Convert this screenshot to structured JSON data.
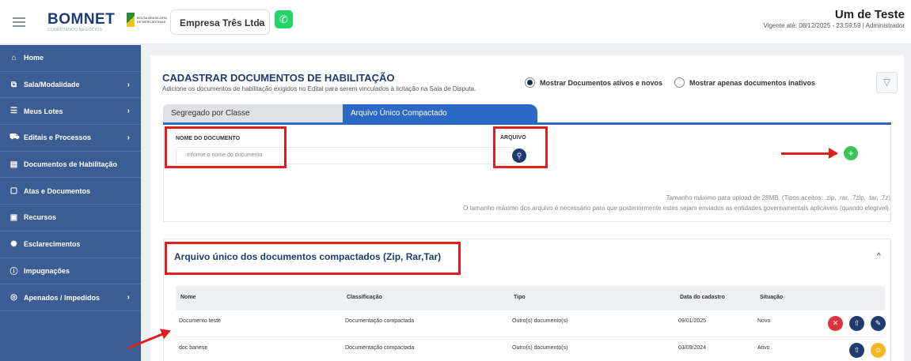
{
  "header": {
    "logo": "BOMNET",
    "logo_sub": "CONECTANDO NEGÓCIOS",
    "bolsa_text": "BOLSA BRASILEIRA DE MERCADORIAS",
    "company": "Empresa Três Ltda",
    "user_name": "Um de Teste",
    "vigente": "Vigente até: 08/12/2025 - 23:59:59 | Administrador"
  },
  "sidebar": {
    "items": [
      {
        "label": "Home",
        "icon": "home-icon",
        "glyph": "⌂",
        "arrow": ""
      },
      {
        "label": "Sala/Modalidade",
        "icon": "rooms-icon",
        "glyph": "⧉",
        "arrow": "›"
      },
      {
        "label": "Meus Lotes",
        "icon": "lots-icon",
        "glyph": "☰",
        "arrow": "›"
      },
      {
        "label": "Editais e Processos",
        "icon": "cart-icon",
        "glyph": "⛟",
        "arrow": "›"
      },
      {
        "label": "Documentos de Habilitação",
        "icon": "document-icon",
        "glyph": "▤",
        "arrow": ""
      },
      {
        "label": "Atas e Documentos",
        "icon": "file-icon",
        "glyph": "▢",
        "arrow": ""
      },
      {
        "label": "Recursos",
        "icon": "resources-icon",
        "glyph": "▣",
        "arrow": ""
      },
      {
        "label": "Esclarecimentos",
        "icon": "sun-icon",
        "glyph": "✺",
        "arrow": ""
      },
      {
        "label": "Impugnações",
        "icon": "info-icon",
        "glyph": "ⓘ",
        "arrow": ""
      },
      {
        "label": "Apenados / Impedidos",
        "icon": "blocked-icon",
        "glyph": "◎",
        "arrow": "›"
      }
    ]
  },
  "page": {
    "title": "CADASTRAR DOCUMENTOS DE HABILITAÇÃO",
    "subtitle": "Adicione os documentos de habilitação exigidos no Edital para serem vinculados à licitação na Sala de Disputa.",
    "radio_active": "Mostrar Documentos ativos e novos",
    "radio_inactive": "Mostrar apenas documentos inativos",
    "tab1": "Segregado por Classe",
    "tab2": "Arquivo Único Compactado"
  },
  "form": {
    "nome_label": "NOME DO DOCUMENTO",
    "nome_placeholder": "Informe o nome do documento",
    "arquivo_label": "ARQUIVO",
    "hint1": "Tamanho máximo para upload de 28MB. (Tipos aceitos: .zip, .rar, .7zip, .tar, .7z)",
    "hint2": "O tamanho máximo dos arquivo é necessário para que posteriormente estes sejam enviados as entidades governamentais aplicáveis (quando elegível)."
  },
  "section": {
    "title": "Arquivo único dos documentos compactados (Zip, Rar,Tar)",
    "columns": [
      "Nome",
      "Classificação",
      "Tipo",
      "Data do cadastro",
      "Situação"
    ],
    "rows": [
      {
        "nome": "Documento teste",
        "classificacao": "Documentação compactada",
        "tipo": "Outro(s) documento(s)",
        "data": "09/01/2025",
        "situacao": "Novo"
      },
      {
        "nome": "doc banese",
        "classificacao": "Documentação compactada",
        "tipo": "Outro(s) documento(s)",
        "data": "03/09/2024",
        "situacao": "Ativo"
      }
    ]
  },
  "colors": {
    "sidebar": "#3b5d94",
    "accent": "#2b69c4",
    "title": "#1f3b6f",
    "annotation": "#e01e1e",
    "add": "#3cc45a"
  }
}
